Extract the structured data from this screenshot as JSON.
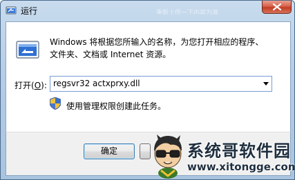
{
  "window": {
    "title": "运行",
    "title_faint": "重新上传一下内容为准"
  },
  "icons": {
    "title": "run-icon",
    "close": "close-icon",
    "main": "run-program-icon",
    "dropdown": "chevron-down-icon",
    "shield": "uac-shield-icon"
  },
  "dialog": {
    "description_line1": "Windows 将根据您所输入的名称，为您打开相应的程序、",
    "description_line2": "文件夹、文档或 Internet 资源。",
    "open_label_prefix": "打开(",
    "open_label_hotkey": "O",
    "open_label_suffix": "):",
    "open_value": "regsvr32 actxprxy.dll",
    "admin_note": "使用管理权限创建此任务。"
  },
  "buttons": {
    "ok": "确定",
    "cancel": ""
  },
  "watermark": {
    "brand": "系统哥软件园",
    "url": "www.xitongge.com"
  },
  "colors": {
    "close_button": "#c23d23",
    "combo_border": "#7a9cd3",
    "watermark_text": "#1f2f3f"
  }
}
